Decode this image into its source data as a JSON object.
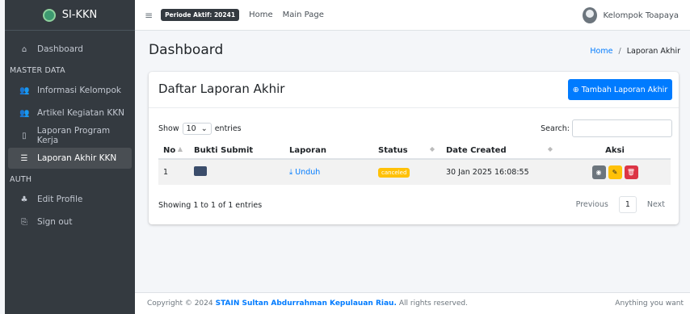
{
  "sidebar": {
    "brand": "SI-KKN",
    "items": [
      {
        "label": "Dashboard",
        "icon": "home-icon"
      },
      {
        "label": "Informasi Kelompok",
        "icon": "users-icon"
      },
      {
        "label": "Artikel Kegiatan KKN",
        "icon": "users-icon"
      },
      {
        "label": "Laporan Program Kerja",
        "icon": "file-icon"
      },
      {
        "label": "Laporan Akhir KKN",
        "icon": "list-icon"
      },
      {
        "label": "Edit Profile",
        "icon": "user-edit-icon"
      },
      {
        "label": "Sign out",
        "icon": "sign-out-icon"
      }
    ],
    "headers": {
      "master": "MASTER DATA",
      "auth": "AUTH"
    }
  },
  "topbar": {
    "periode": "Periode Aktif: 20241",
    "links": [
      "Home",
      "Main Page"
    ],
    "user": "Kelompok Toapaya"
  },
  "page": {
    "title": "Dashboard",
    "breadcrumb_home": "Home",
    "breadcrumb_sep": "/",
    "breadcrumb_current": "Laporan Akhir"
  },
  "card": {
    "title": "Daftar Laporan Akhir",
    "add_button": "Tambah Laporan Akhir",
    "show_label": "Show",
    "entries_value": "10",
    "entries_label": "entries",
    "search_label": "Search:",
    "columns": [
      "No",
      "Bukti Submit",
      "Laporan",
      "Status",
      "Date Created",
      "Aksi"
    ],
    "rows": [
      {
        "no": "1",
        "laporan": "Unduh",
        "status": "canceled",
        "date": "30 Jan 2025 16:08:55"
      }
    ],
    "showing": "Showing 1 to 1 of 1 entries",
    "pager": {
      "prev": "Previous",
      "current": "1",
      "next": "Next"
    }
  },
  "footer": {
    "prefix": "Copyright © 2024",
    "link": "STAIN Sultan Abdurrahman Kepulauan Riau.",
    "suffix": "All rights reserved.",
    "right": "Anything you want"
  },
  "colors": {
    "primary": "#007bff",
    "sidebar": "#343a40",
    "warning": "#ffc107",
    "danger": "#dc3545"
  }
}
